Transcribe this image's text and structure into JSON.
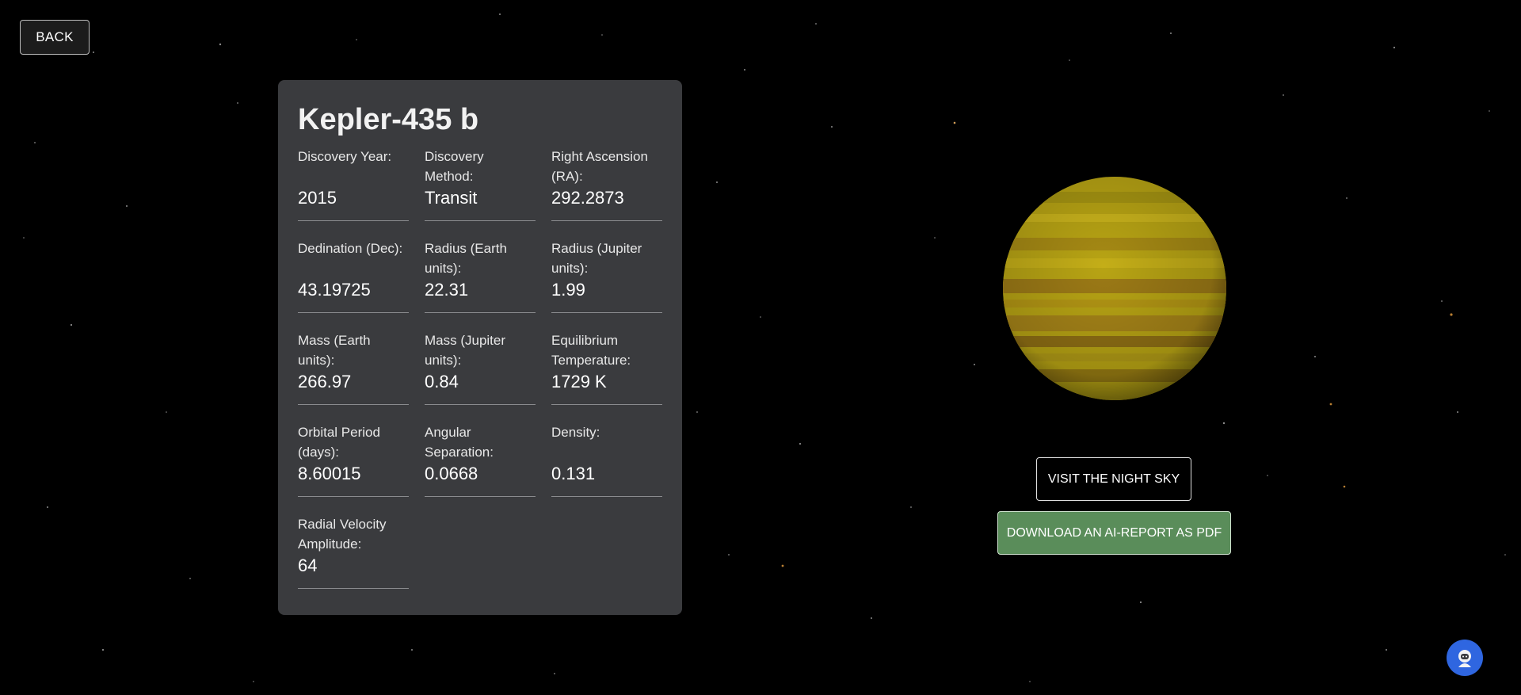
{
  "nav": {
    "back_label": "BACK"
  },
  "planet_card": {
    "title": "Kepler-435 b",
    "fields": [
      {
        "label": "Discovery Year:",
        "value": "2015"
      },
      {
        "label": "Discovery Method:",
        "value": "Transit"
      },
      {
        "label": "Right Ascension (RA):",
        "value": "292.2873"
      },
      {
        "label": "Dedination (Dec):",
        "value": "43.19725"
      },
      {
        "label": "Radius (Earth units):",
        "value": "22.31"
      },
      {
        "label": "Radius (Jupiter units):",
        "value": "1.99"
      },
      {
        "label": "Mass (Earth units):",
        "value": "266.97"
      },
      {
        "label": "Mass (Jupiter units):",
        "value": "0.84"
      },
      {
        "label": "Equilibrium Temperature:",
        "value": "1729 K"
      },
      {
        "label": "Orbital Period (days):",
        "value": "8.60015"
      },
      {
        "label": "Angular Separation:",
        "value": "0.0668"
      },
      {
        "label": "Density:",
        "value": "0.131"
      },
      {
        "label": "Radial Velocity Amplitude:",
        "value": "64"
      }
    ]
  },
  "actions": {
    "night_sky_label": "VISIT THE NIGHT SKY",
    "pdf_label": "DOWNLOAD AN AI-REPORT AS PDF"
  },
  "colors": {
    "background": "#000000",
    "card": "#3a3b3e",
    "pdf_button": "#5a8d5a",
    "assistant_button": "#2f66e0",
    "planet_base": "#b8a414"
  },
  "icons": {
    "assistant": "astronaut-icon",
    "planet": "planet-render"
  }
}
